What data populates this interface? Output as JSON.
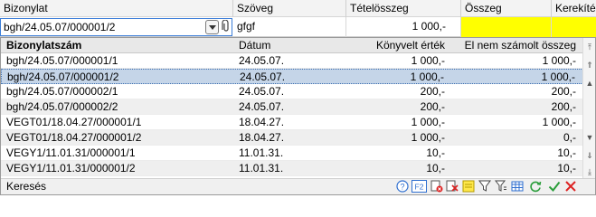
{
  "header": {
    "col1": "Bizonylat",
    "col2": "Szöveg",
    "col3": "Tételösszeg",
    "col4": "Összeg",
    "col5": "Kerekítés"
  },
  "edit_row": {
    "bizonylat_value": "bgh/24.05.07/000001/2",
    "szoveg_value": "gfgf",
    "tetelosszeg_value": "1 000,-",
    "osszeg_value": "",
    "kerekites_value": ""
  },
  "popup": {
    "columns": [
      "Bizonylatszám",
      "Dátum",
      "Könyvelt érték",
      "El nem számolt összeg"
    ],
    "rows": [
      [
        "bgh/24.05.07/000001/1",
        "24.05.07.",
        "1 000,-",
        "1 000,-"
      ],
      [
        "bgh/24.05.07/000001/2",
        "24.05.07.",
        "1 000,-",
        "1 000,-"
      ],
      [
        "bgh/24.05.07/000002/1",
        "24.05.07.",
        "200,-",
        "200,-"
      ],
      [
        "bgh/24.05.07/000002/2",
        "24.05.07.",
        "200,-",
        "200,-"
      ],
      [
        "VEGT01/18.04.27/000001/1",
        "18.04.27.",
        "1 000,-",
        "1 000,-"
      ],
      [
        "VEGT01/18.04.27/000001/2",
        "18.04.27.",
        "1 000,-",
        "0,-"
      ],
      [
        "VEGY1/11.01.31/000001/1",
        "11.01.31.",
        "10,-",
        "10,-"
      ],
      [
        "VEGY1/11.01.31/000001/2",
        "11.01.31.",
        "10,-",
        "10,-"
      ]
    ],
    "selected_row": 1,
    "footer_label": "Keresés"
  },
  "colors": {
    "selection": "#c5d5e8",
    "highlight_yellow": "#ffff00",
    "accent_blue": "#3b7dd8"
  },
  "icons": {
    "clip": "paperclip-icon",
    "toolbar": [
      "help-icon",
      "f2-icon",
      "clear-filter-icon",
      "delete-icon",
      "sticky-note-icon",
      "filter-icon",
      "filter-settings-icon",
      "table-icon",
      "refresh-icon",
      "ok-check-icon",
      "cancel-x-icon"
    ]
  }
}
